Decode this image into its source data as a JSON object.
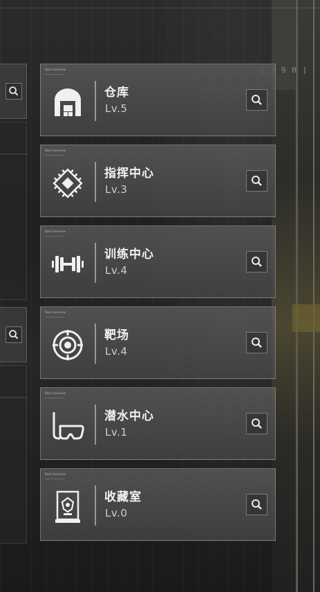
{
  "background": {
    "corner_bracket_text": "[ 3 9 0 ]"
  },
  "buildings": [
    {
      "id": "warehouse",
      "name": "仓库",
      "level": "Lv.5",
      "icon": "warehouse-icon",
      "tag": "Base Overview"
    },
    {
      "id": "command",
      "name": "指挥中心",
      "level": "Lv.3",
      "icon": "chip-icon",
      "tag": "Base Overview"
    },
    {
      "id": "training",
      "name": "训练中心",
      "level": "Lv.4",
      "icon": "dumbbell-icon",
      "tag": "Base Overview"
    },
    {
      "id": "range",
      "name": "靶场",
      "level": "Lv.4",
      "icon": "target-icon",
      "tag": "Base Overview"
    },
    {
      "id": "diving",
      "name": "潜水中心",
      "level": "Lv.1",
      "icon": "diving-mask-icon",
      "tag": "Base Overview"
    },
    {
      "id": "collection",
      "name": "收藏室",
      "level": "Lv.0",
      "icon": "display-case-icon",
      "tag": "Base Overview"
    }
  ],
  "colors": {
    "card_border": "#9a9a9a",
    "text_primary": "#f2f2f2",
    "text_secondary": "#cfcfcf"
  }
}
